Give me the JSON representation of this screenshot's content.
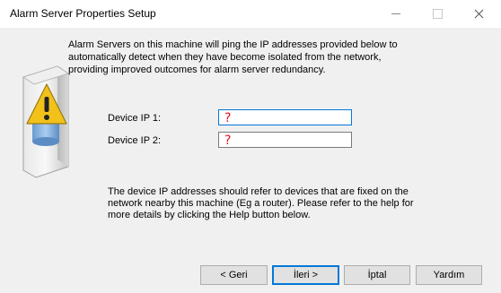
{
  "window": {
    "title": "Alarm Server Properties Setup"
  },
  "intro_text": "Alarm Servers on this machine will ping the IP addresses provided below to automatically detect when they have become isolated from the network, providing improved outcomes for alarm server redundancy.",
  "fields": [
    {
      "label": "Device IP 1:",
      "value": "?"
    },
    {
      "label": "Device IP 2:",
      "value": "?"
    }
  ],
  "bottom_text": "The device IP addresses should refer to devices that are fixed on the network nearby this machine (Eg a router).  Please refer to the help for more details by clicking the Help button below.",
  "buttons": {
    "back": "< Geri",
    "next": "İleri >",
    "cancel": "İptal",
    "help": "Yardım"
  },
  "icons": {
    "server_warning": "server-warning-icon"
  },
  "colors": {
    "focus_border": "#0078d7",
    "invalid_mark": "#e81123",
    "dialog_bg": "#f0f0f0"
  }
}
